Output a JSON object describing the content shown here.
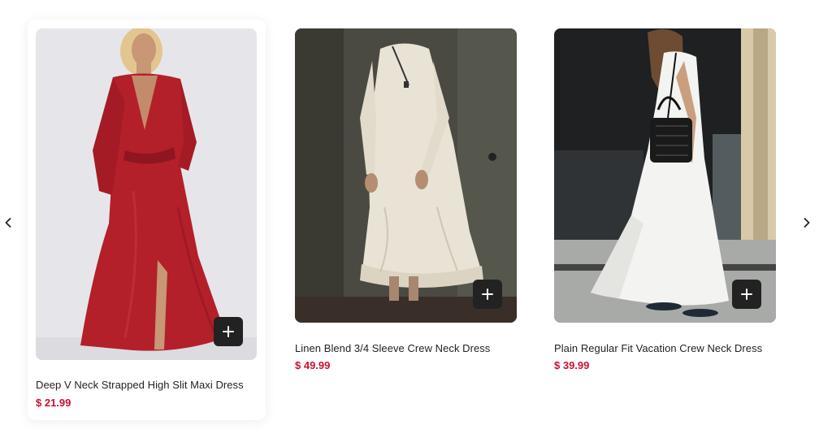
{
  "carousel": {
    "prev_icon": "chevron-left-icon",
    "next_icon": "chevron-right-icon",
    "add_icon": "plus-icon",
    "products": [
      {
        "title": "Deep V Neck Strapped High Slit Maxi Dress",
        "price": "$ 21.99",
        "image": "red satin wrap maxi dress",
        "dress_color": "#b3202a"
      },
      {
        "title": "Linen Blend 3/4 Sleeve Crew Neck Dress",
        "price": "$ 49.99",
        "image": "cream linen tiered dress",
        "dress_color": "#e9e3d5"
      },
      {
        "title": "Plain Regular Fit Vacation Crew Neck Dress",
        "price": "$ 39.99",
        "image": "white sleeveless maxi dress",
        "dress_color": "#f3f3f1"
      }
    ]
  },
  "colors": {
    "price": "#c8102e",
    "button": "#222222",
    "text": "#222222"
  }
}
